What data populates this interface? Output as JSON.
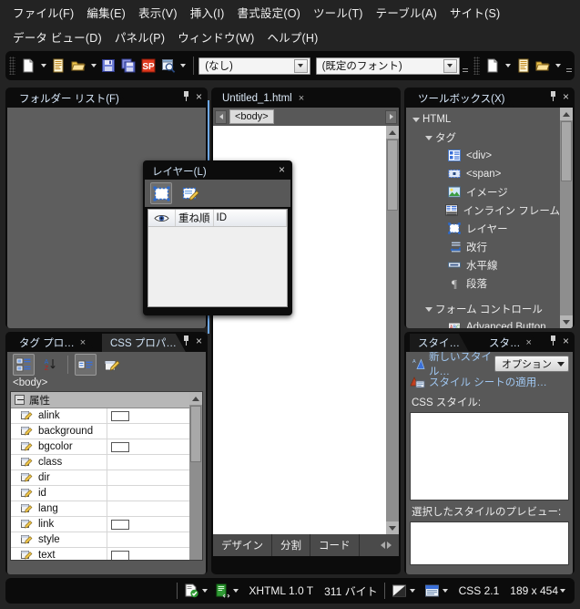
{
  "menu": {
    "row1": [
      {
        "label": "ファイル(F)",
        "name": "menu-file"
      },
      {
        "label": "編集(E)",
        "name": "menu-edit"
      },
      {
        "label": "表示(V)",
        "name": "menu-view"
      },
      {
        "label": "挿入(I)",
        "name": "menu-insert"
      },
      {
        "label": "書式設定(O)",
        "name": "menu-format"
      },
      {
        "label": "ツール(T)",
        "name": "menu-tools"
      },
      {
        "label": "テーブル(A)",
        "name": "menu-table"
      },
      {
        "label": "サイト(S)",
        "name": "menu-site"
      }
    ],
    "row2": [
      {
        "label": "データ ビュー(D)",
        "name": "menu-dataview"
      },
      {
        "label": "パネル(P)",
        "name": "menu-panel"
      },
      {
        "label": "ウィンドウ(W)",
        "name": "menu-window"
      },
      {
        "label": "ヘルプ(H)",
        "name": "menu-help"
      }
    ]
  },
  "toolbar": {
    "icons": [
      "new-page-icon",
      "new-page-dropdown",
      "new-document-icon",
      "open-folder-icon",
      "open-dropdown",
      "save-icon",
      "save-all-icon",
      "sharepoint-icon",
      "preview-browser-icon",
      "preview-dropdown"
    ],
    "style_combo": {
      "value": "(なし)",
      "name": "style-combo"
    },
    "font_combo": {
      "value": "(既定のフォント)",
      "name": "font-combo"
    },
    "icons2": [
      "new-page-icon",
      "new-document-icon",
      "open-folder-icon"
    ]
  },
  "folder_list": {
    "tab_label": "フォルダー リスト(F)",
    "pin": "pin-icon",
    "close": "×"
  },
  "layers_panel": {
    "title": "レイヤー(L)",
    "close": "×",
    "buttons": [
      "insert-layer-icon",
      "edit-layer-icon"
    ],
    "columns": [
      "重ね順",
      "ID"
    ],
    "eye_column": "eye-icon"
  },
  "document": {
    "tab_label": "Untitled_1.html",
    "tab_close": "×",
    "quick_tag": "<body>",
    "view_tabs": [
      {
        "label": "デザイン",
        "active": true
      },
      {
        "label": "分割",
        "active": false
      },
      {
        "label": "コード",
        "active": false
      }
    ]
  },
  "toolbox": {
    "tab_label": "ツールボックス(X)",
    "tree": [
      {
        "label": "HTML",
        "depth": 0,
        "twisty": true,
        "icon": null
      },
      {
        "label": "タグ",
        "depth": 1,
        "twisty": true,
        "icon": null
      },
      {
        "label": "<div>",
        "depth": 2,
        "twisty": false,
        "icon": "div-icon"
      },
      {
        "label": "<span>",
        "depth": 2,
        "twisty": false,
        "icon": "span-icon"
      },
      {
        "label": "イメージ",
        "depth": 2,
        "twisty": false,
        "icon": "image-icon"
      },
      {
        "label": "インライン フレーム",
        "depth": 2,
        "twisty": false,
        "icon": "iframe-icon"
      },
      {
        "label": "レイヤー",
        "depth": 2,
        "twisty": false,
        "icon": "layer-icon"
      },
      {
        "label": "改行",
        "depth": 2,
        "twisty": false,
        "icon": "linebreak-icon"
      },
      {
        "label": "水平線",
        "depth": 2,
        "twisty": false,
        "icon": "hr-icon"
      },
      {
        "label": "段落",
        "depth": 2,
        "twisty": false,
        "icon": "paragraph-icon"
      },
      {
        "label": "",
        "depth": 0,
        "twisty": false,
        "icon": null
      },
      {
        "label": "フォーム コントロール",
        "depth": 1,
        "twisty": true,
        "icon": null
      },
      {
        "label": "Advanced Button",
        "depth": 2,
        "twisty": false,
        "icon": "abc-button-icon"
      }
    ]
  },
  "tag_properties": {
    "tabs": [
      {
        "label": "タグ プロ…",
        "active": true,
        "close": "×"
      },
      {
        "label": "CSS プロパ…",
        "active": false,
        "close": ""
      }
    ],
    "toolbar_icons": [
      "group-by-category-icon",
      "sort-alpha-icon",
      "show-set-props-icon",
      "edit-tag-icon"
    ],
    "tag_name": "<body>",
    "group_label": "属性",
    "rows": [
      {
        "name": "alink",
        "value": "",
        "swatch": true
      },
      {
        "name": "background",
        "value": "",
        "swatch": false
      },
      {
        "name": "bgcolor",
        "value": "",
        "swatch": true
      },
      {
        "name": "class",
        "value": "",
        "swatch": false
      },
      {
        "name": "dir",
        "value": "",
        "swatch": false
      },
      {
        "name": "id",
        "value": "",
        "swatch": false
      },
      {
        "name": "lang",
        "value": "",
        "swatch": false
      },
      {
        "name": "link",
        "value": "",
        "swatch": true
      },
      {
        "name": "style",
        "value": "",
        "swatch": false
      },
      {
        "name": "text",
        "value": "",
        "swatch": true
      }
    ]
  },
  "styles_panel": {
    "tabs": [
      {
        "label": "スタイ…",
        "active": false
      },
      {
        "label": "スタ…",
        "active": true,
        "close": "×"
      }
    ],
    "new_style_link": "新しいスタイル…",
    "options_button": "オプション",
    "apply_stylesheet_link": "スタイル シートの適用…",
    "css_styles_label": "CSS スタイル:",
    "preview_label": "選択したスタイルのプレビュー:"
  },
  "status_bar": {
    "icons": [
      "html-check-icon",
      "css-check-icon"
    ],
    "doctype": "XHTML 1.0 T",
    "size": "311 バイト",
    "render_icon": "contrast-icon",
    "visual_icon": "page-style-icon",
    "css_version": "CSS 2.1",
    "dimensions": "189 x 454"
  },
  "colors": {
    "panel_bg": "#585858",
    "chrome_bg": "#232323",
    "toolbar_bg": "#0b0b0b",
    "tab_text": "#cfe2f5",
    "link_text": "#9fc6f0",
    "guide_line": "#6ea8e8"
  }
}
